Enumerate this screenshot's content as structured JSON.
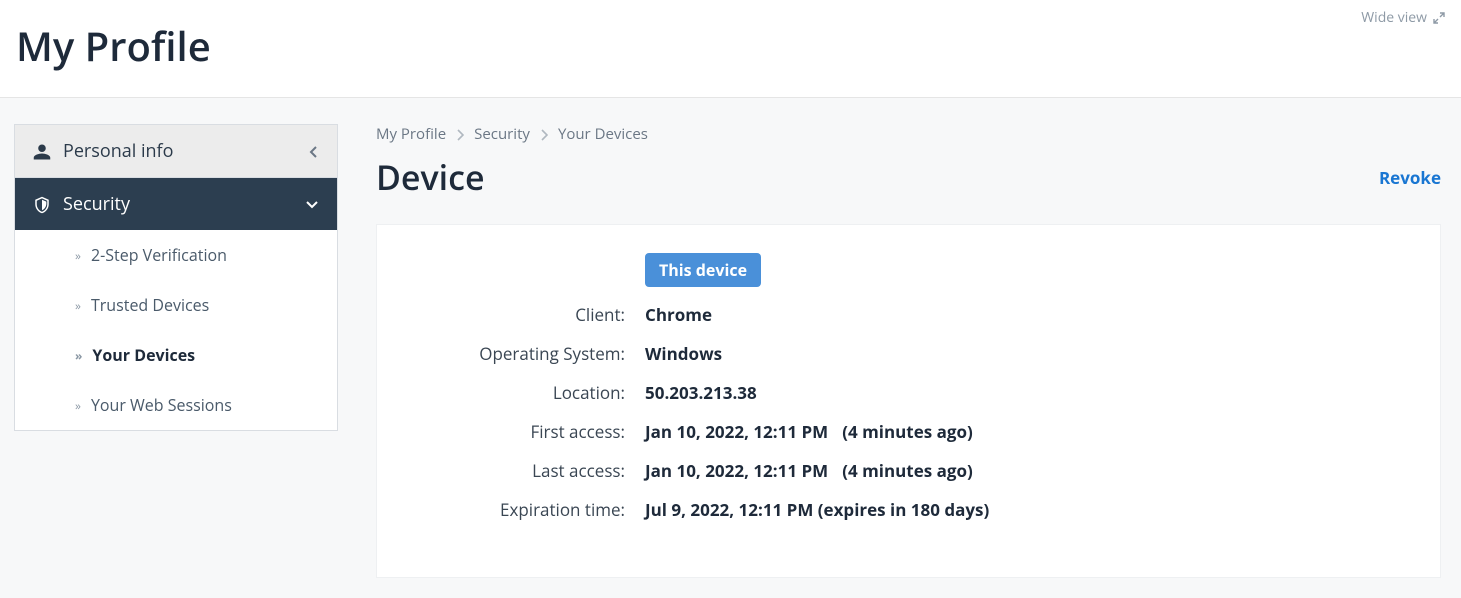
{
  "header": {
    "page_title": "My Profile",
    "wide_view": "Wide view"
  },
  "sidebar": {
    "personal_info": "Personal info",
    "security": "Security",
    "sub_items": [
      {
        "label": "2-Step Verification"
      },
      {
        "label": "Trusted Devices"
      },
      {
        "label": "Your Devices"
      },
      {
        "label": "Your Web Sessions"
      }
    ]
  },
  "breadcrumb": {
    "item0": "My Profile",
    "item1": "Security",
    "item2": "Your Devices"
  },
  "content": {
    "title": "Device",
    "revoke": "Revoke",
    "badge": "This device",
    "rows": {
      "client_label": "Client:",
      "client_value": "Chrome",
      "os_label": "Operating System:",
      "os_value": "Windows",
      "location_label": "Location:",
      "location_value": "50.203.213.38",
      "first_access_label": "First access:",
      "first_access_value": "Jan 10, 2022, 12:11 PM",
      "first_access_rel": "(4 minutes ago)",
      "last_access_label": "Last access:",
      "last_access_value": "Jan 10, 2022, 12:11 PM",
      "last_access_rel": "(4 minutes ago)",
      "expiration_label": "Expiration time:",
      "expiration_value": "Jul 9, 2022, 12:11 PM (expires in 180 days)"
    }
  }
}
